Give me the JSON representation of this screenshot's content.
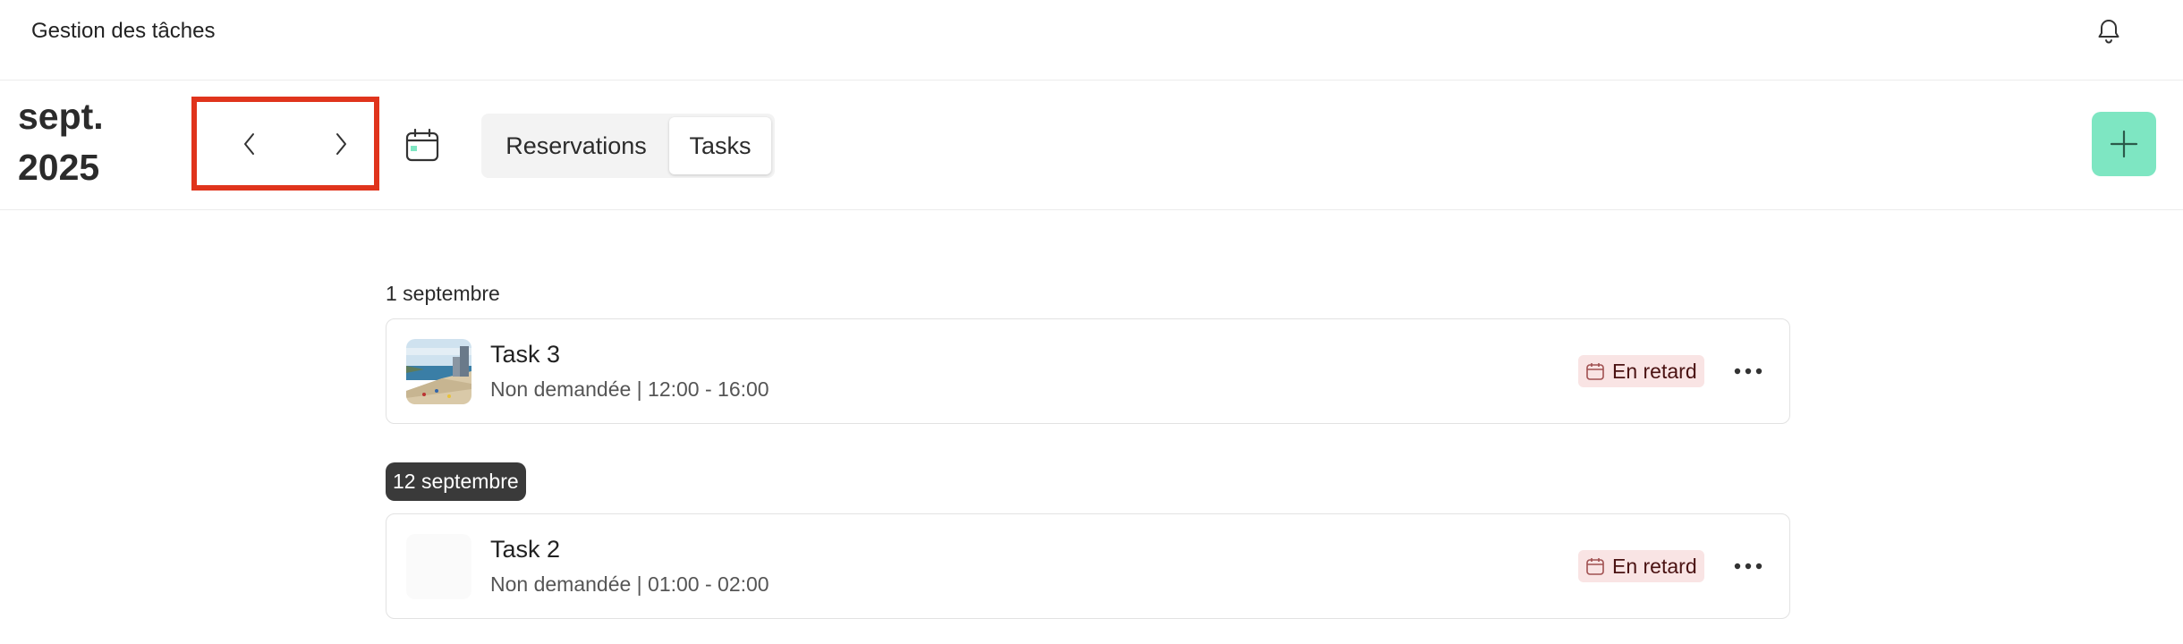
{
  "header": {
    "title": "Gestion des tâches",
    "bell_icon": "bell-icon"
  },
  "toolbar": {
    "month_line1": "sept.",
    "month_line2": "2025",
    "prev_icon": "chevron-left-icon",
    "next_icon": "chevron-right-icon",
    "calendar_icon": "calendar-icon",
    "tabs": [
      {
        "label": "Reservations",
        "selected": false
      },
      {
        "label": "Tasks",
        "selected": true
      }
    ],
    "add_icon": "plus-icon",
    "accent_color": "#7ee6c2",
    "highlight_color": "#e0341c"
  },
  "groups": [
    {
      "date": "1 septembre",
      "tasks": [
        {
          "title": "Task 3",
          "subtitle": "Non demandée | 12:00 - 16:00",
          "badge": "En retard",
          "has_image": true
        }
      ]
    },
    {
      "date": "12 septembre",
      "date_highlighted": true,
      "tasks": [
        {
          "title": "Task 2",
          "subtitle": "Non demandée | 01:00 - 02:00",
          "badge": "En retard",
          "has_image": false
        }
      ]
    }
  ]
}
